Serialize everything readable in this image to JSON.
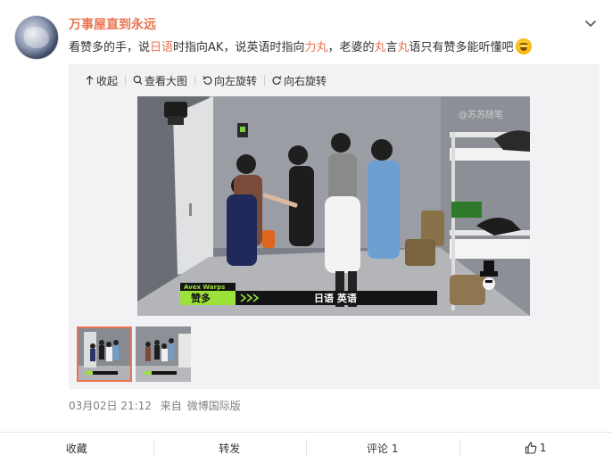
{
  "post": {
    "username": "万事屋直到永远",
    "text_parts": {
      "p1": "看赞多的手，说",
      "h1": "日语",
      "p2": "时指向AK，说英语时指向",
      "h2": "力丸",
      "p3": "，老婆的",
      "h3": "丸",
      "p4": "言",
      "h4": "丸",
      "p5": "语只有赞多能听懂吧"
    },
    "emoji": "laugh-cry-emoji",
    "timestamp": "03月02日 21:12",
    "source_prefix": "来自",
    "source": "微博国际版"
  },
  "media_toolbar": {
    "collapse": "收起",
    "view_large": "查看大图",
    "rotate_left": "向左旋转",
    "rotate_right": "向右旋转"
  },
  "video_overlay": {
    "watermark": "@苏苏随笔",
    "tag": "Avex Warps",
    "name": "赞多",
    "caption": "日语 英语"
  },
  "actions": {
    "favorite": "收藏",
    "repost": "转发",
    "comment": "评论 1",
    "like_count": "1"
  },
  "colors": {
    "accent": "#eb7350",
    "text": "#333333",
    "muted": "#808080",
    "media_bg": "#f2f2f5"
  }
}
